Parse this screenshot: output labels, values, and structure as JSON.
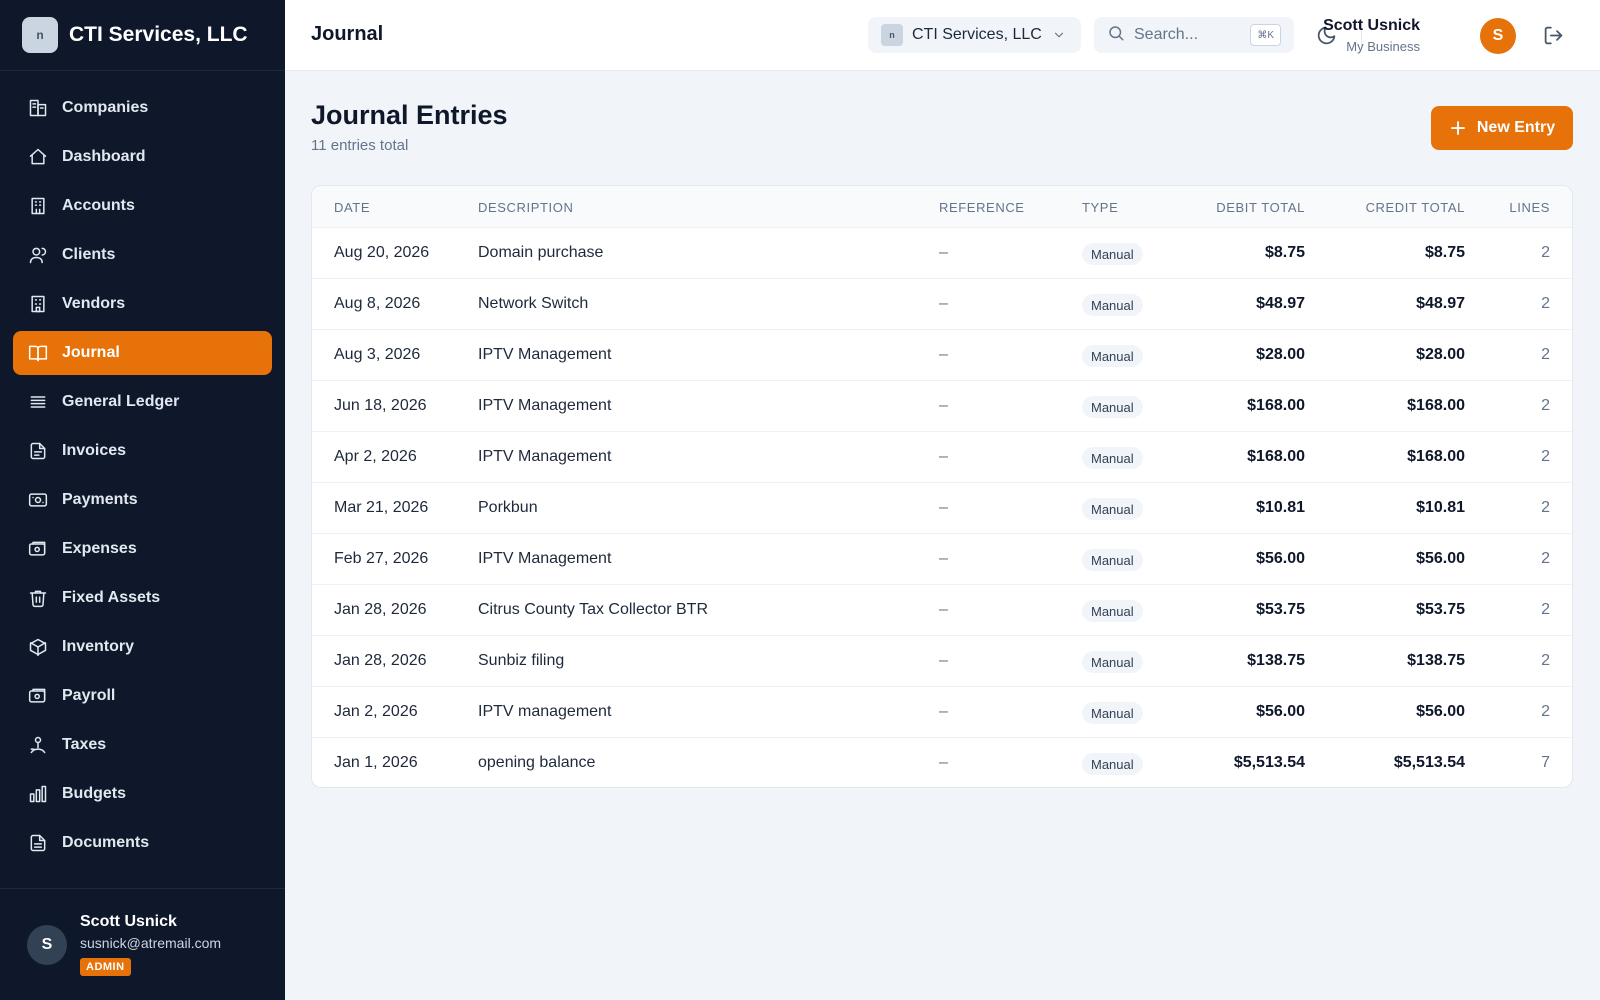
{
  "brand": {
    "name": "CTI Services, LLC",
    "logo_text": "n"
  },
  "sidebar": {
    "items": [
      {
        "label": "Companies",
        "icon": "companies-icon"
      },
      {
        "label": "Dashboard",
        "icon": "home-icon"
      },
      {
        "label": "Accounts",
        "icon": "building-icon"
      },
      {
        "label": "Clients",
        "icon": "users-icon"
      },
      {
        "label": "Vendors",
        "icon": "store-icon"
      },
      {
        "label": "Journal",
        "icon": "book-icon",
        "active": true
      },
      {
        "label": "General Ledger",
        "icon": "list-icon"
      },
      {
        "label": "Invoices",
        "icon": "file-icon"
      },
      {
        "label": "Payments",
        "icon": "banknote-icon"
      },
      {
        "label": "Expenses",
        "icon": "wallet-icon"
      },
      {
        "label": "Fixed Assets",
        "icon": "trash-icon"
      },
      {
        "label": "Inventory",
        "icon": "box-icon"
      },
      {
        "label": "Payroll",
        "icon": "money-icon"
      },
      {
        "label": "Taxes",
        "icon": "hand-coins-icon"
      },
      {
        "label": "Budgets",
        "icon": "bar-chart-icon"
      },
      {
        "label": "Documents",
        "icon": "document-icon"
      }
    ],
    "user": {
      "initial": "S",
      "name": "Scott Usnick",
      "email": "susnick@atremail.com",
      "role_badge": "ADMIN"
    }
  },
  "header": {
    "title": "Journal",
    "company_selector": "CTI Services, LLC",
    "search": {
      "placeholder": "Search...",
      "shortcut": "⌘K"
    },
    "user": {
      "name": "Scott Usnick",
      "subtitle": "My Business",
      "initial": "S"
    }
  },
  "main": {
    "title": "Journal Entries",
    "subtitle": "11 entries total",
    "new_button": "New Entry",
    "table": {
      "columns": {
        "date": "DATE",
        "description": "DESCRIPTION",
        "reference": "REFERENCE",
        "type": "TYPE",
        "debit": "DEBIT TOTAL",
        "credit": "CREDIT TOTAL",
        "lines": "LINES"
      },
      "rows": [
        {
          "date": "Aug 20, 2026",
          "description": "Domain purchase",
          "reference": "–",
          "type": "Manual",
          "debit": "$8.75",
          "credit": "$8.75",
          "lines": "2"
        },
        {
          "date": "Aug 8, 2026",
          "description": "Network Switch",
          "reference": "–",
          "type": "Manual",
          "debit": "$48.97",
          "credit": "$48.97",
          "lines": "2"
        },
        {
          "date": "Aug 3, 2026",
          "description": "IPTV Management",
          "reference": "–",
          "type": "Manual",
          "debit": "$28.00",
          "credit": "$28.00",
          "lines": "2"
        },
        {
          "date": "Jun 18, 2026",
          "description": "IPTV Management",
          "reference": "–",
          "type": "Manual",
          "debit": "$168.00",
          "credit": "$168.00",
          "lines": "2"
        },
        {
          "date": "Apr 2, 2026",
          "description": "IPTV Management",
          "reference": "–",
          "type": "Manual",
          "debit": "$168.00",
          "credit": "$168.00",
          "lines": "2"
        },
        {
          "date": "Mar 21, 2026",
          "description": "Porkbun",
          "reference": "–",
          "type": "Manual",
          "debit": "$10.81",
          "credit": "$10.81",
          "lines": "2"
        },
        {
          "date": "Feb 27, 2026",
          "description": "IPTV Management",
          "reference": "–",
          "type": "Manual",
          "debit": "$56.00",
          "credit": "$56.00",
          "lines": "2"
        },
        {
          "date": "Jan 28, 2026",
          "description": "Citrus County Tax Collector BTR",
          "reference": "–",
          "type": "Manual",
          "debit": "$53.75",
          "credit": "$53.75",
          "lines": "2"
        },
        {
          "date": "Jan 28, 2026",
          "description": "Sunbiz filing",
          "reference": "–",
          "type": "Manual",
          "debit": "$138.75",
          "credit": "$138.75",
          "lines": "2"
        },
        {
          "date": "Jan 2, 2026",
          "description": "IPTV management",
          "reference": "–",
          "type": "Manual",
          "debit": "$56.00",
          "credit": "$56.00",
          "lines": "2"
        },
        {
          "date": "Jan 1, 2026",
          "description": "opening balance",
          "reference": "–",
          "type": "Manual",
          "debit": "$5,513.54",
          "credit": "$5,513.54",
          "lines": "7"
        }
      ]
    }
  },
  "colors": {
    "accent": "#e67209",
    "sidebar_bg": "#0f172a",
    "page_bg": "#f1f5f9"
  }
}
